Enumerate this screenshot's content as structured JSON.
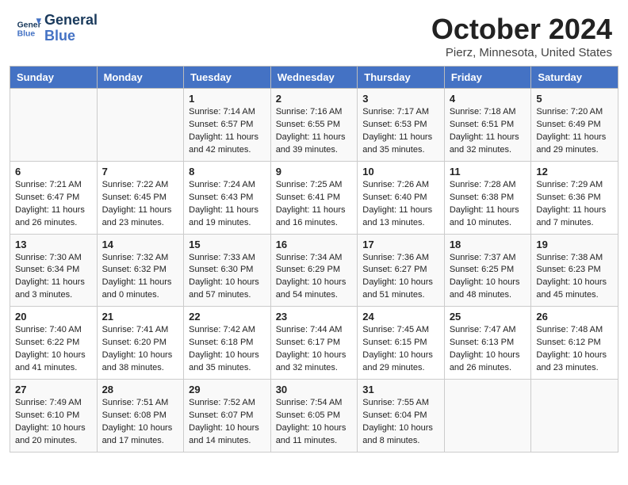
{
  "header": {
    "logo_line1": "General",
    "logo_line2": "Blue",
    "month_title": "October 2024",
    "location": "Pierz, Minnesota, United States"
  },
  "days_of_week": [
    "Sunday",
    "Monday",
    "Tuesday",
    "Wednesday",
    "Thursday",
    "Friday",
    "Saturday"
  ],
  "weeks": [
    [
      {
        "day": "",
        "info": ""
      },
      {
        "day": "",
        "info": ""
      },
      {
        "day": "1",
        "info": "Sunrise: 7:14 AM\nSunset: 6:57 PM\nDaylight: 11 hours and 42 minutes."
      },
      {
        "day": "2",
        "info": "Sunrise: 7:16 AM\nSunset: 6:55 PM\nDaylight: 11 hours and 39 minutes."
      },
      {
        "day": "3",
        "info": "Sunrise: 7:17 AM\nSunset: 6:53 PM\nDaylight: 11 hours and 35 minutes."
      },
      {
        "day": "4",
        "info": "Sunrise: 7:18 AM\nSunset: 6:51 PM\nDaylight: 11 hours and 32 minutes."
      },
      {
        "day": "5",
        "info": "Sunrise: 7:20 AM\nSunset: 6:49 PM\nDaylight: 11 hours and 29 minutes."
      }
    ],
    [
      {
        "day": "6",
        "info": "Sunrise: 7:21 AM\nSunset: 6:47 PM\nDaylight: 11 hours and 26 minutes."
      },
      {
        "day": "7",
        "info": "Sunrise: 7:22 AM\nSunset: 6:45 PM\nDaylight: 11 hours and 23 minutes."
      },
      {
        "day": "8",
        "info": "Sunrise: 7:24 AM\nSunset: 6:43 PM\nDaylight: 11 hours and 19 minutes."
      },
      {
        "day": "9",
        "info": "Sunrise: 7:25 AM\nSunset: 6:41 PM\nDaylight: 11 hours and 16 minutes."
      },
      {
        "day": "10",
        "info": "Sunrise: 7:26 AM\nSunset: 6:40 PM\nDaylight: 11 hours and 13 minutes."
      },
      {
        "day": "11",
        "info": "Sunrise: 7:28 AM\nSunset: 6:38 PM\nDaylight: 11 hours and 10 minutes."
      },
      {
        "day": "12",
        "info": "Sunrise: 7:29 AM\nSunset: 6:36 PM\nDaylight: 11 hours and 7 minutes."
      }
    ],
    [
      {
        "day": "13",
        "info": "Sunrise: 7:30 AM\nSunset: 6:34 PM\nDaylight: 11 hours and 3 minutes."
      },
      {
        "day": "14",
        "info": "Sunrise: 7:32 AM\nSunset: 6:32 PM\nDaylight: 11 hours and 0 minutes."
      },
      {
        "day": "15",
        "info": "Sunrise: 7:33 AM\nSunset: 6:30 PM\nDaylight: 10 hours and 57 minutes."
      },
      {
        "day": "16",
        "info": "Sunrise: 7:34 AM\nSunset: 6:29 PM\nDaylight: 10 hours and 54 minutes."
      },
      {
        "day": "17",
        "info": "Sunrise: 7:36 AM\nSunset: 6:27 PM\nDaylight: 10 hours and 51 minutes."
      },
      {
        "day": "18",
        "info": "Sunrise: 7:37 AM\nSunset: 6:25 PM\nDaylight: 10 hours and 48 minutes."
      },
      {
        "day": "19",
        "info": "Sunrise: 7:38 AM\nSunset: 6:23 PM\nDaylight: 10 hours and 45 minutes."
      }
    ],
    [
      {
        "day": "20",
        "info": "Sunrise: 7:40 AM\nSunset: 6:22 PM\nDaylight: 10 hours and 41 minutes."
      },
      {
        "day": "21",
        "info": "Sunrise: 7:41 AM\nSunset: 6:20 PM\nDaylight: 10 hours and 38 minutes."
      },
      {
        "day": "22",
        "info": "Sunrise: 7:42 AM\nSunset: 6:18 PM\nDaylight: 10 hours and 35 minutes."
      },
      {
        "day": "23",
        "info": "Sunrise: 7:44 AM\nSunset: 6:17 PM\nDaylight: 10 hours and 32 minutes."
      },
      {
        "day": "24",
        "info": "Sunrise: 7:45 AM\nSunset: 6:15 PM\nDaylight: 10 hours and 29 minutes."
      },
      {
        "day": "25",
        "info": "Sunrise: 7:47 AM\nSunset: 6:13 PM\nDaylight: 10 hours and 26 minutes."
      },
      {
        "day": "26",
        "info": "Sunrise: 7:48 AM\nSunset: 6:12 PM\nDaylight: 10 hours and 23 minutes."
      }
    ],
    [
      {
        "day": "27",
        "info": "Sunrise: 7:49 AM\nSunset: 6:10 PM\nDaylight: 10 hours and 20 minutes."
      },
      {
        "day": "28",
        "info": "Sunrise: 7:51 AM\nSunset: 6:08 PM\nDaylight: 10 hours and 17 minutes."
      },
      {
        "day": "29",
        "info": "Sunrise: 7:52 AM\nSunset: 6:07 PM\nDaylight: 10 hours and 14 minutes."
      },
      {
        "day": "30",
        "info": "Sunrise: 7:54 AM\nSunset: 6:05 PM\nDaylight: 10 hours and 11 minutes."
      },
      {
        "day": "31",
        "info": "Sunrise: 7:55 AM\nSunset: 6:04 PM\nDaylight: 10 hours and 8 minutes."
      },
      {
        "day": "",
        "info": ""
      },
      {
        "day": "",
        "info": ""
      }
    ]
  ]
}
